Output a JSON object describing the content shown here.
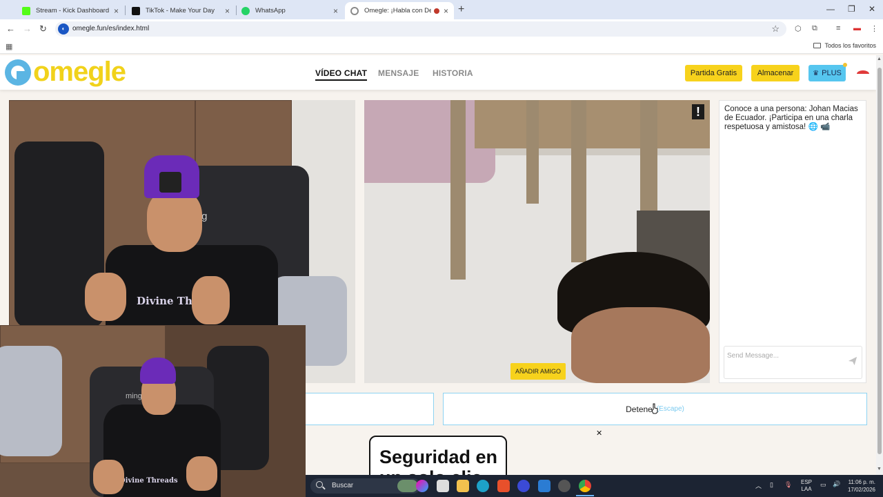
{
  "browser": {
    "tabs": [
      {
        "title": "Stream - Kick Dashboard",
        "favicon_color": "#53fc18"
      },
      {
        "title": "TikTok - Make Your Day",
        "favicon_color": "#111111"
      },
      {
        "title": "WhatsApp",
        "favicon_color": "#25d366"
      },
      {
        "title": "Omegle: ¡Habla con Descon",
        "favicon_color": "#8a8a8a",
        "active": true
      }
    ],
    "url": "omegle.fun/es/index.html",
    "bookmarks_label": "Todos los favoritos"
  },
  "site": {
    "logo_text": "omegle",
    "nav": [
      {
        "label": "VÍDEO CHAT",
        "active": true
      },
      {
        "label": "MENSAJE"
      },
      {
        "label": "HISTORIA"
      }
    ],
    "buttons": {
      "free_match": "Partida Gratis",
      "store": "Almacenar",
      "plus": "PLUS"
    },
    "colors": {
      "brand_yellow": "#f7d21c",
      "plus_blue": "#56c6ef",
      "accent_border": "#8ed3f2"
    }
  },
  "video": {
    "report_symbol": "!",
    "add_friend": "AÑADIR AMIGO",
    "left_shirt_text": "Divine Thread",
    "self_shirt_text": "Divine Threads"
  },
  "chat": {
    "message": "Conoce a una persona: Johan Macias de Ecuador. ¡Participa en una charla respetuosa y amistosa! 🌐 📹",
    "input_placeholder": "Send Message..."
  },
  "controls": {
    "stop_label": "Detener",
    "stop_hint": "(Escape)"
  },
  "promo": {
    "text_line1": "Seguridad en",
    "text_line2": "un solo clic"
  },
  "taskbar": {
    "search_label": "Buscar",
    "language": "ESP",
    "layout": "LAA",
    "time": "11:06 p. m.",
    "date": "17/02/2026"
  }
}
